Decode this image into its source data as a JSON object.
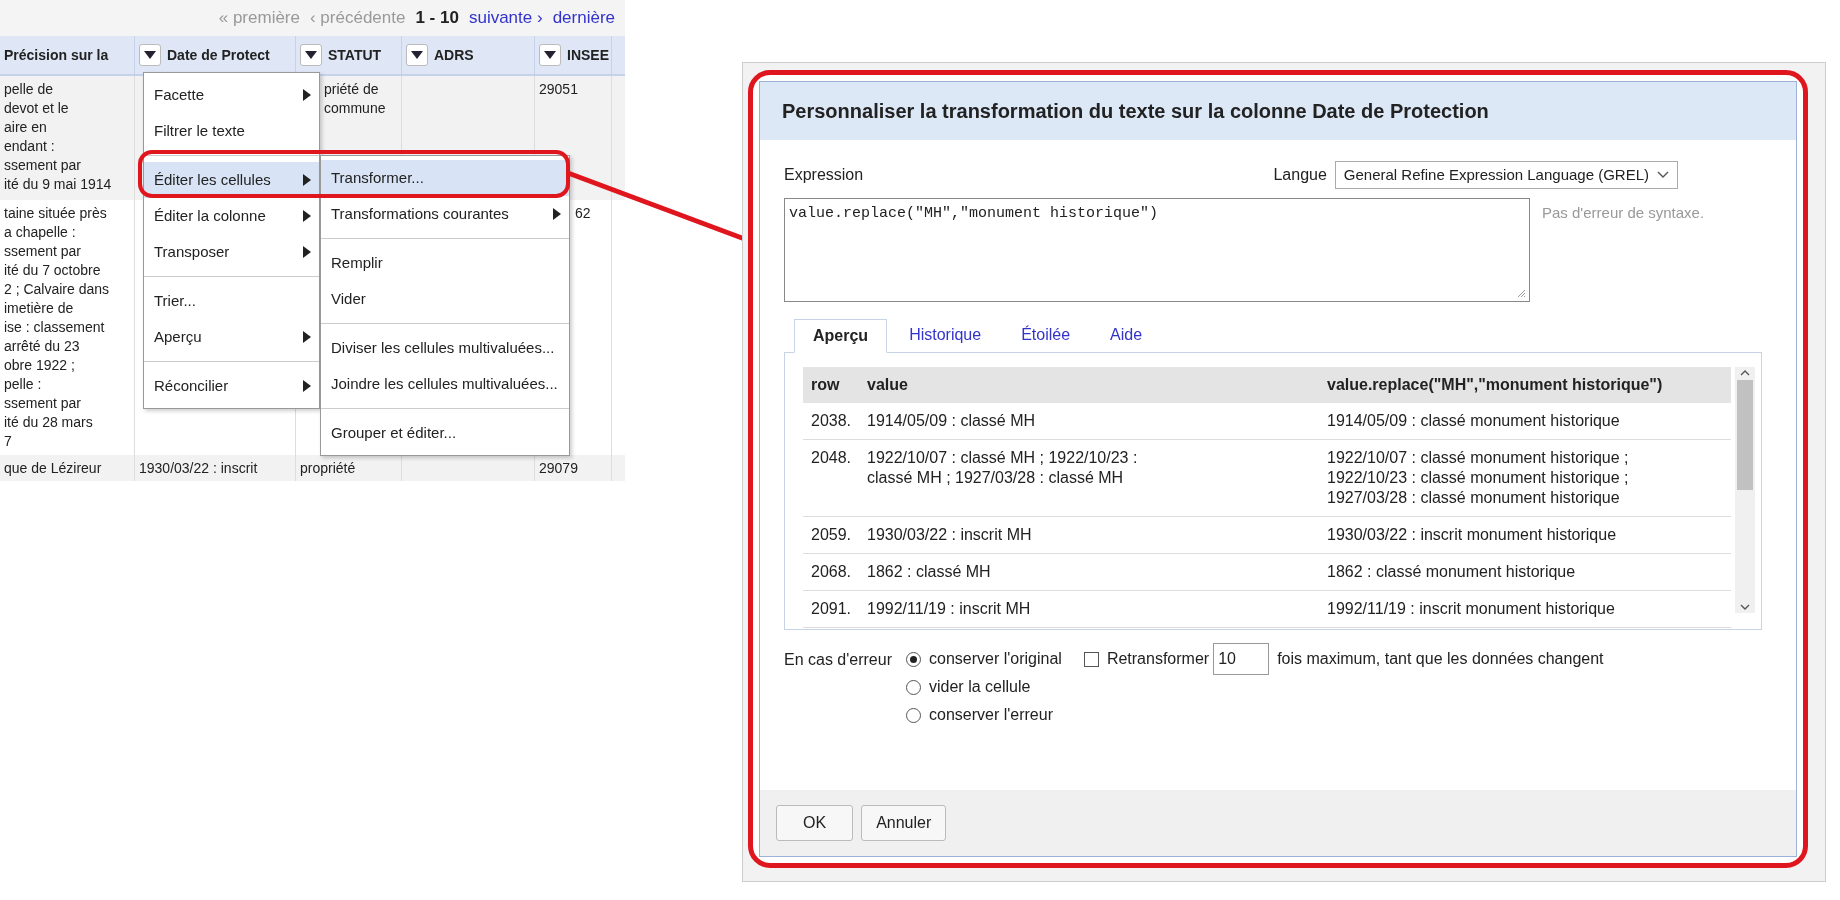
{
  "pager": {
    "first": "« première",
    "prev": "‹ précédente",
    "range": "1 - 10",
    "next": "suivante ›",
    "last": "dernière"
  },
  "table": {
    "columns": [
      {
        "label": "Précision sur la",
        "menu": false
      },
      {
        "label": "Date de Protect",
        "menu": true
      },
      {
        "label": "STATUT",
        "menu": true
      },
      {
        "label": "ADRS",
        "menu": true
      },
      {
        "label": "INSEE",
        "menu": true
      }
    ],
    "rows": [
      [
        "pelle de\ndevot et le\naire en\nendant :\nssement par\nité du 9 mai 1914",
        "",
        "priété de\ncommune",
        "",
        "29051"
      ],
      [
        "taine située près\na chapelle :\nssement par\nité du 7 octobre\n2 ; Calvaire dans\nimetière de\nise : classement\narrêté du 23\nobre 1922 ;\npelle :\nssement par\nité du 28 mars\n7",
        "",
        "",
        "",
        "62"
      ],
      [
        "que de Lézireur",
        "1930/03/22 : inscrit",
        "propriété",
        "",
        "29079"
      ]
    ]
  },
  "column_menu": {
    "groups": [
      [
        {
          "label": "Facette",
          "submenu": true,
          "selected": false
        },
        {
          "label": "Filtrer le texte",
          "submenu": false,
          "selected": false
        }
      ],
      [
        {
          "label": "Éditer les cellules",
          "submenu": true,
          "selected": true
        },
        {
          "label": "Éditer la colonne",
          "submenu": true,
          "selected": false
        },
        {
          "label": "Transposer",
          "submenu": true,
          "selected": false
        }
      ],
      [
        {
          "label": "Trier...",
          "submenu": false,
          "selected": false
        },
        {
          "label": "Aperçu",
          "submenu": true,
          "selected": false
        }
      ],
      [
        {
          "label": "Réconcilier",
          "submenu": true,
          "selected": false
        }
      ]
    ]
  },
  "cell_menu": {
    "groups": [
      [
        {
          "label": "Transformer...",
          "submenu": false,
          "selected": true
        },
        {
          "label": "Transformations courantes",
          "submenu": true,
          "selected": false
        }
      ],
      [
        {
          "label": "Remplir",
          "submenu": false,
          "selected": false
        },
        {
          "label": "Vider",
          "submenu": false,
          "selected": false
        }
      ],
      [
        {
          "label": "Diviser les cellules multivaluées...",
          "submenu": false,
          "selected": false
        },
        {
          "label": "Joindre les cellules multivaluées...",
          "submenu": false,
          "selected": false
        }
      ],
      [
        {
          "label": "Grouper et éditer...",
          "submenu": false,
          "selected": false
        }
      ]
    ]
  },
  "dialog": {
    "title": "Personnaliser la transformation du texte sur la colonne Date de Protection",
    "expression_label": "Expression",
    "language_label": "Langue",
    "language": "General Refine Expression Language (GREL)",
    "expression": "value.replace(\"MH\",\"monument historique\")",
    "syntax_status": "Pas d'erreur de syntaxe.",
    "tabs": [
      {
        "label": "Aperçu",
        "selected": true
      },
      {
        "label": "Historique",
        "selected": false
      },
      {
        "label": "Étoilée",
        "selected": false
      },
      {
        "label": "Aide",
        "selected": false
      }
    ],
    "preview_columns": [
      "row",
      "value",
      "value.replace(\"MH\",\"monument historique\")"
    ],
    "preview_rows": [
      {
        "row": "2038.",
        "value": "1914/05/09 : classé MH",
        "result": "1914/05/09 : classé monument historique"
      },
      {
        "row": "2048.",
        "value": "1922/10/07 : classé MH ; 1922/10/23 :\nclassé MH ; 1927/03/28 : classé MH",
        "result": "1922/10/07 : classé monument historique ;\n1922/10/23 : classé monument historique ;\n1927/03/28 : classé monument historique"
      },
      {
        "row": "2059.",
        "value": "1930/03/22 : inscrit MH",
        "result": "1930/03/22 : inscrit monument historique"
      },
      {
        "row": "2068.",
        "value": "1862 : classé MH",
        "result": "1862 : classé monument historique"
      },
      {
        "row": "2091.",
        "value": "1992/11/19 : inscrit MH",
        "result": "1992/11/19 : inscrit monument historique"
      }
    ],
    "on_error_label": "En cas d'erreur",
    "on_error_options": [
      {
        "label": "conserver l'original",
        "selected": true
      },
      {
        "label": "vider la cellule",
        "selected": false
      },
      {
        "label": "conserver l'erreur",
        "selected": false
      }
    ],
    "retransform": {
      "label": "Retransformer",
      "checked": false,
      "value": "10",
      "suffix": "fois maximum, tant que les données changent"
    },
    "buttons": [
      "OK",
      "Annuler"
    ]
  }
}
